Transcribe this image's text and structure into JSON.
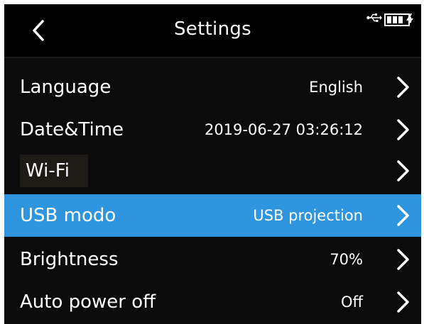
{
  "header": {
    "title": "Settings",
    "back_icon": "chevron-left-icon",
    "status_icons": [
      "usb-icon",
      "battery-charging-icon"
    ]
  },
  "settings": {
    "items": [
      {
        "label": "Language",
        "value": "English"
      },
      {
        "label": "Date&Time",
        "value": "2019-06-27 03:26:12"
      },
      {
        "label": "Wi-Fi",
        "value": ""
      },
      {
        "label": "USB modo",
        "value": "USB projection"
      },
      {
        "label": "Brightness",
        "value": "70%"
      },
      {
        "label": "Auto power off",
        "value": "Off"
      }
    ],
    "selected_index": 3
  },
  "colors": {
    "background": "#0b0b0b",
    "header": "#000000",
    "selected_row": "#2f95de",
    "text": "#ffffff"
  }
}
